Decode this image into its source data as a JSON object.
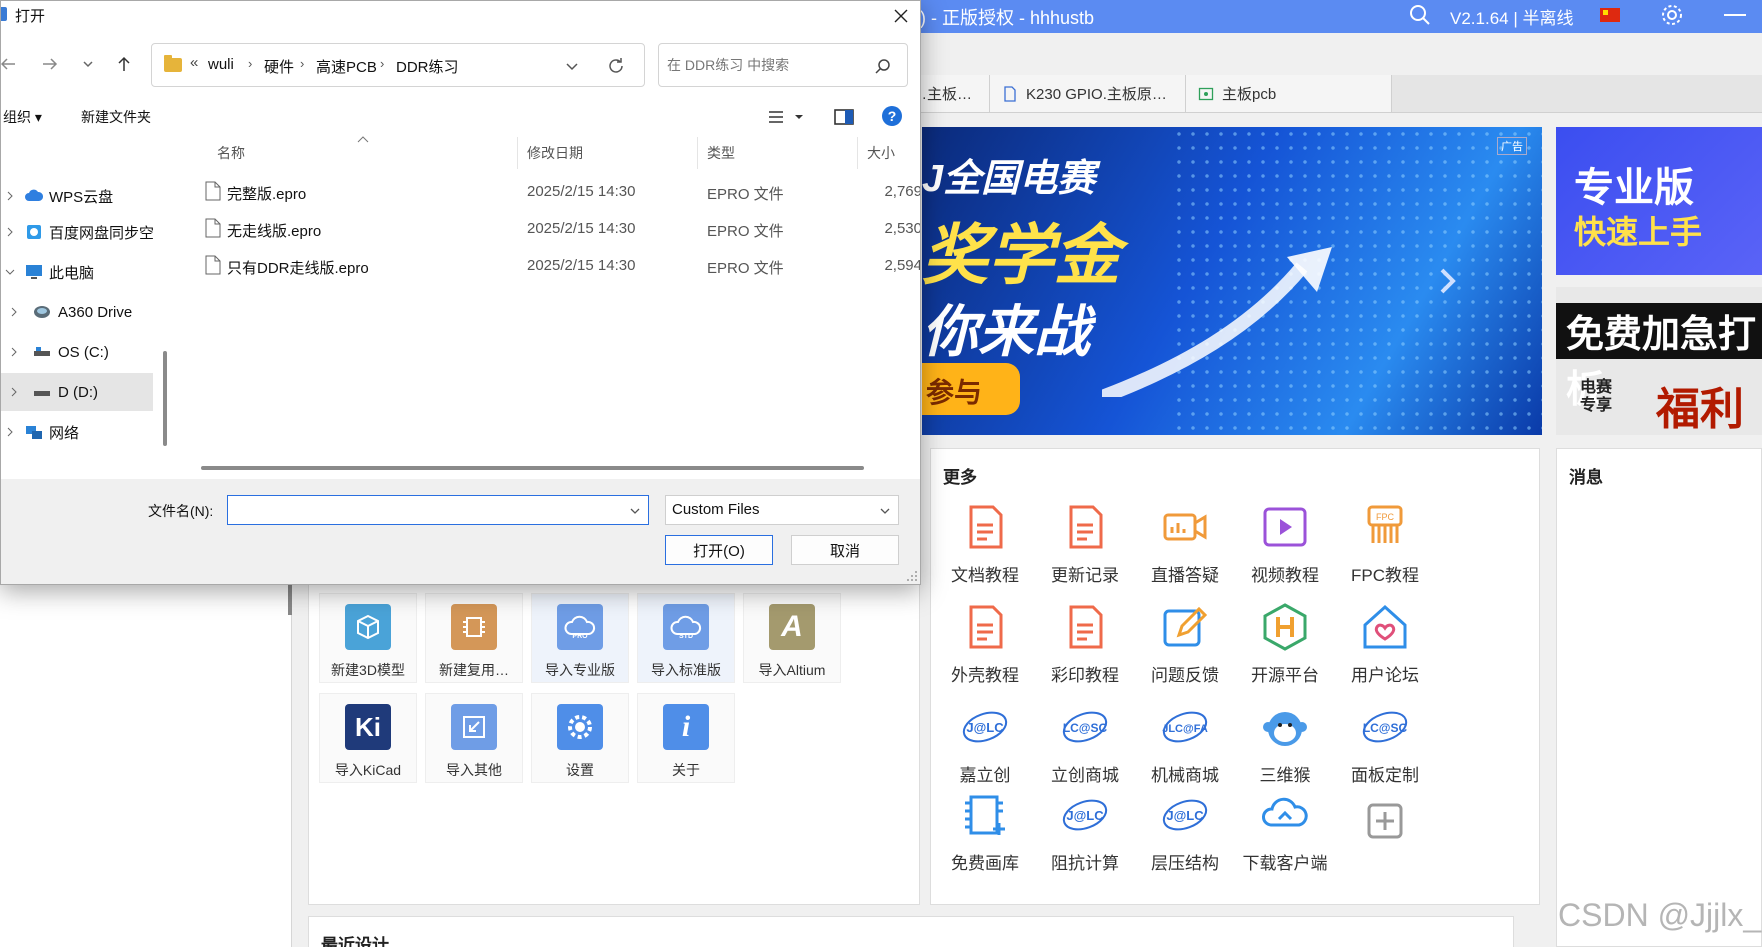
{
  "app": {
    "title": ") - 正版授权 - hhhustb",
    "version": "V2.1.64 | 半离线",
    "tabs": [
      "…主板…",
      "K230 GPIO.主板原…",
      "主板pcb"
    ],
    "quick_actions": [
      {
        "label": "新建3D模型",
        "icon": "cube-icon",
        "color": "#4aa3d8"
      },
      {
        "label": "新建复用…",
        "icon": "chip-icon",
        "color": "#d49758"
      },
      {
        "label": "导入专业版",
        "icon": "cloud-pro-icon",
        "color": "#6f9de6"
      },
      {
        "label": "导入标准版",
        "icon": "cloud-std-icon",
        "color": "#6f9de6"
      },
      {
        "label": "导入Altium",
        "icon": "altium-icon",
        "color": "#a49a6e"
      },
      {
        "label": "导入KiCad",
        "icon": "kicad-icon",
        "color": "#1f3a7a"
      },
      {
        "label": "导入其他",
        "icon": "import-more-icon",
        "color": "#6f9de6"
      },
      {
        "label": "设置",
        "icon": "gear-icon",
        "color": "#4f8ee8"
      },
      {
        "label": "关于",
        "icon": "info-icon",
        "color": "#4f8ee8"
      }
    ],
    "recent_title": "最近设计",
    "banner": {
      "ad_label": "广告",
      "line1": "J全国电赛",
      "line2": "奖学金",
      "line3": "你来战",
      "cta": "参与"
    },
    "promo1": {
      "line1": "专业版",
      "line2": "快速上手"
    },
    "promo2": {
      "line1": "免费加急打板",
      "line2": "电赛专享",
      "line3": "福利"
    },
    "more_title": "更多",
    "more_items": [
      {
        "label": "文档教程",
        "icon": "doc-tutorial-icon"
      },
      {
        "label": "更新记录",
        "icon": "update-log-icon"
      },
      {
        "label": "直播答疑",
        "icon": "live-stream-icon"
      },
      {
        "label": "视频教程",
        "icon": "video-tutorial-icon"
      },
      {
        "label": "FPC教程",
        "icon": "fpc-icon"
      },
      {
        "label": "外壳教程",
        "icon": "enclosure-icon"
      },
      {
        "label": "彩印教程",
        "icon": "color-print-icon"
      },
      {
        "label": "问题反馈",
        "icon": "feedback-icon"
      },
      {
        "label": "开源平台",
        "icon": "open-source-icon"
      },
      {
        "label": "用户论坛",
        "icon": "forum-icon"
      },
      {
        "label": "嘉立创",
        "icon": "jlc-icon"
      },
      {
        "label": "立创商城",
        "icon": "lcsc-icon"
      },
      {
        "label": "机械商城",
        "icon": "jlcfa-icon"
      },
      {
        "label": "三维猴",
        "icon": "monkey-icon"
      },
      {
        "label": "面板定制",
        "icon": "panel-icon"
      },
      {
        "label": "免费画库",
        "icon": "library-icon"
      },
      {
        "label": "阻抗计算",
        "icon": "impedance-icon"
      },
      {
        "label": "层压结构",
        "icon": "stackup-icon"
      },
      {
        "label": "下载客户端",
        "icon": "download-client-icon"
      },
      {
        "label": "",
        "icon": "add-icon"
      }
    ],
    "messages_title": "消息",
    "watermark": "CSDN @Jjjlx_"
  },
  "dialog": {
    "title": "打开",
    "path": {
      "more": "«",
      "crumbs": [
        "wuli",
        "硬件",
        "高速PCB",
        "DDR练习"
      ]
    },
    "search_placeholder": "在 DDR练习 中搜索",
    "toolbar": {
      "organize": "组织 ▾",
      "new_folder": "新建文件夹"
    },
    "nav_tree": [
      {
        "label": "WPS云盘",
        "icon": "wps-cloud-icon"
      },
      {
        "label": "百度网盘同步空",
        "icon": "baidu-netdisk-icon"
      },
      {
        "label": "此电脑",
        "icon": "this-pc-icon"
      },
      {
        "label": "A360 Drive",
        "icon": "a360-drive-icon"
      },
      {
        "label": "OS (C:)",
        "icon": "drive-c-icon"
      },
      {
        "label": "D (D:)",
        "icon": "drive-d-icon"
      },
      {
        "label": "网络",
        "icon": "network-icon"
      }
    ],
    "columns": {
      "name": "名称",
      "date": "修改日期",
      "type": "类型",
      "size": "大小"
    },
    "files": [
      {
        "name": "完整版.epro",
        "date": "2025/2/15 14:30",
        "type": "EPRO 文件",
        "size": "2,769"
      },
      {
        "name": "无走线版.epro",
        "date": "2025/2/15 14:30",
        "type": "EPRO 文件",
        "size": "2,530"
      },
      {
        "name": "只有DDR走线版.epro",
        "date": "2025/2/15 14:30",
        "type": "EPRO 文件",
        "size": "2,594"
      }
    ],
    "filename_label": "文件名(N):",
    "filename_value": "",
    "filetype_value": "Custom Files",
    "open_label": "打开(O)",
    "cancel_label": "取消"
  }
}
